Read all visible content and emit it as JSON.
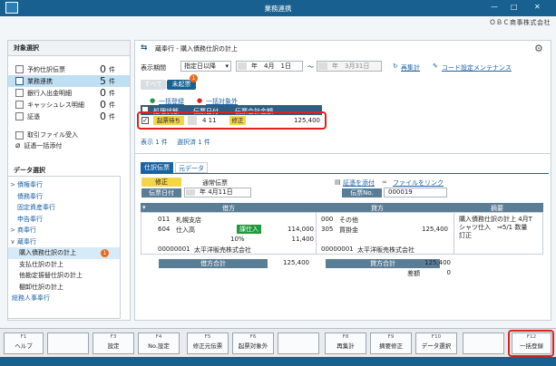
{
  "titlebar": {
    "title": "業務連携",
    "min": "—",
    "max": "□",
    "close": "✕"
  },
  "company": "ＯＢＣ商事株式会社",
  "left": {
    "target_header": "対象選択",
    "counts": [
      {
        "label": "予約仕訳伝票",
        "num": "0",
        "unit": "件"
      },
      {
        "label": "業務連携",
        "num": "5",
        "unit": "件"
      },
      {
        "label": "銀行入出金明細",
        "num": "0",
        "unit": "件"
      },
      {
        "label": "キャッシュレス明細",
        "num": "0",
        "unit": "件"
      },
      {
        "label": "証憑",
        "num": "0",
        "unit": "件"
      }
    ],
    "actions": [
      "取引ファイル受入",
      "証憑一括添付"
    ],
    "data_header": "データ選択",
    "tree": [
      {
        "chev": ">",
        "label": "債権奉行",
        "sel": false
      },
      {
        "chev": "",
        "label": "債務奉行",
        "sel": false
      },
      {
        "chev": "",
        "label": "固定資産奉行",
        "sel": false
      },
      {
        "chev": "",
        "label": "申告奉行",
        "sel": false
      },
      {
        "chev": ">",
        "label": "商奉行",
        "sel": false
      },
      {
        "chev": "∨",
        "label": "蔵奉行",
        "sel": false
      },
      {
        "chev": "",
        "label": "購入債務仕訳の計上",
        "sel": true,
        "badge": "1"
      },
      {
        "chev": "",
        "label": "支払仕訳の計上",
        "sel": false
      },
      {
        "chev": "",
        "label": "他勘定振替仕訳の計上",
        "sel": false
      },
      {
        "chev": "",
        "label": "棚卸仕訳の計上",
        "sel": false
      },
      {
        "chev": "",
        "label": "総務人事奉行",
        "sel": false
      }
    ]
  },
  "main": {
    "title": "蔵奉行 ‐ 購入債務仕訳の計上",
    "period_label": "表示期間",
    "period_select": "指定日以降",
    "date_from": "年　4月　1日",
    "tilde": "～",
    "date_to": "年　3月31日",
    "recalc": "再集計",
    "code_setting": "コード設定メンテナンス",
    "filter_all": "すべて",
    "filter_unposted": "未起票",
    "filter_badge": "1",
    "bulk_register": "一括登録",
    "bulk_exclude": "一括対象外",
    "table_headers": [
      "処理状態",
      "伝票日付",
      "伝票合計金額"
    ],
    "row": {
      "status": "起票待ち",
      "date": "4 11",
      "tag": "修正",
      "amount": "125,400"
    },
    "summary_count": "表示 1 件",
    "summary_sel": "選択済 1 件",
    "tabs": [
      "仕訳伝票",
      "元データ"
    ],
    "fix_badge": "修正",
    "normal_slip": "通常伝票",
    "slip_date_label": "伝票日付",
    "slip_date": "年 4月11日",
    "attach": "証憑を添付",
    "file_link": "ファイルをリンク",
    "slip_no_label": "伝票No.",
    "slip_no": "000019",
    "entry_headers": [
      "借方",
      "貸方",
      "摘要"
    ],
    "debit": {
      "dept_code": "011",
      "dept": "札幌支店",
      "acct_code": "604",
      "acct": "仕入高",
      "tax": "課仕入",
      "amount": "114,000",
      "rate": "10%",
      "tax_amount": "11,400",
      "partner_code": "00000001",
      "partner": "太平洋販売株式会社"
    },
    "credit": {
      "dept_code": "000",
      "dept": "その他",
      "acct_code": "305",
      "acct": "買掛金",
      "amount": "125,400",
      "partner_code": "00000001",
      "partner": "太平洋販売株式会社"
    },
    "memo": "購入債務仕訳の計上 4月Tシャツ仕入　⇒5/1 数量訂正",
    "debit_total_label": "借方合計",
    "debit_total": "125,400",
    "credit_total_label": "貸方合計",
    "credit_total": "125,400",
    "diff_label": "差額",
    "diff": "0"
  },
  "fkeys": [
    {
      "k": "F1",
      "l": "ヘルプ"
    },
    {
      "k": "",
      "l": ""
    },
    {
      "k": "F3",
      "l": "設定"
    },
    {
      "k": "F4",
      "l": "No.設定"
    },
    {
      "k": "F5",
      "l": "修正元伝票"
    },
    {
      "k": "F6",
      "l": "起票対象外"
    },
    {
      "k": "",
      "l": ""
    },
    {
      "k": "F8",
      "l": "再集計"
    },
    {
      "k": "F9",
      "l": "摘要修正"
    },
    {
      "k": "F10",
      "l": "データ選択"
    },
    {
      "k": "",
      "l": ""
    },
    {
      "k": "F12",
      "l": "一括登録"
    }
  ],
  "colors": {
    "titlebar": "#17608f",
    "selected": "#bfe0f3",
    "red_highlight": "#e0201b",
    "link": "#1a62a3",
    "green_tag": "#1f9a3d",
    "yellow_tag": "#f3d54a"
  }
}
